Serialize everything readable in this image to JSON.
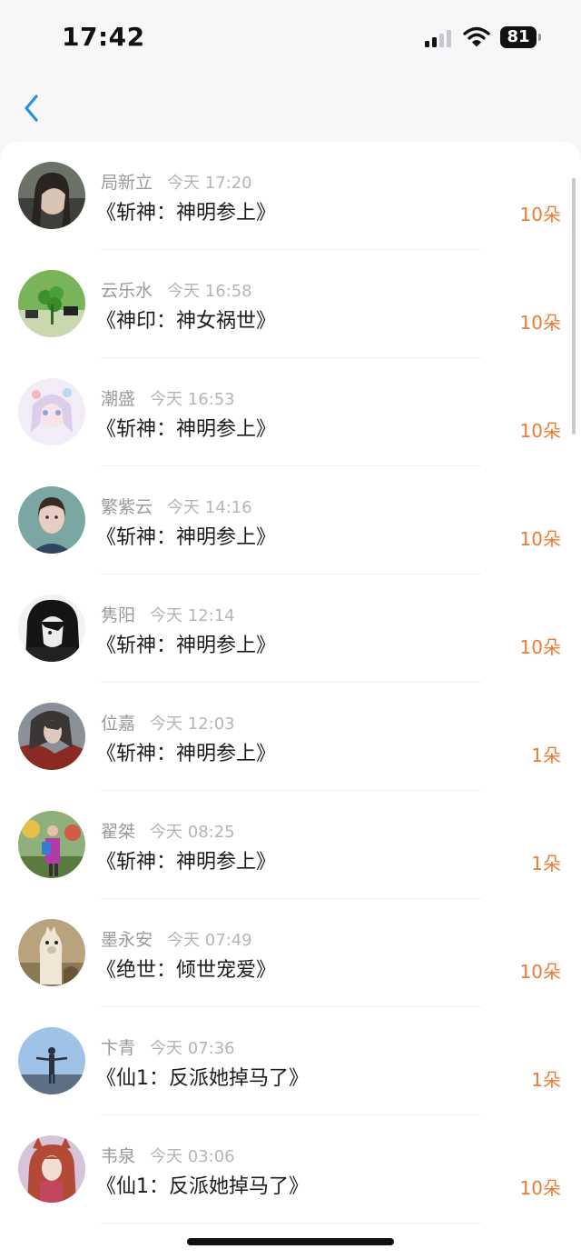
{
  "status_bar": {
    "time": "17:42",
    "battery": "81"
  },
  "list": [
    {
      "name": "局新立",
      "time": "今天 17:20",
      "book": "《斩神：神明参上》",
      "amount": "10朵"
    },
    {
      "name": "云乐水",
      "time": "今天 16:58",
      "book": "《神印：神女祸世》",
      "amount": "10朵"
    },
    {
      "name": "潮盛",
      "time": "今天 16:53",
      "book": "《斩神：神明参上》",
      "amount": "10朵"
    },
    {
      "name": "繁紫云",
      "time": "今天 14:16",
      "book": "《斩神：神明参上》",
      "amount": "10朵"
    },
    {
      "name": "隽阳",
      "time": "今天 12:14",
      "book": "《斩神：神明参上》",
      "amount": "10朵"
    },
    {
      "name": "位嘉",
      "time": "今天 12:03",
      "book": "《斩神：神明参上》",
      "amount": "1朵"
    },
    {
      "name": "翟桀",
      "time": "今天 08:25",
      "book": "《斩神：神明参上》",
      "amount": "1朵"
    },
    {
      "name": "墨永安",
      "time": "今天 07:49",
      "book": "《绝世：倾世宠爱》",
      "amount": "10朵"
    },
    {
      "name": "卞青",
      "time": "今天 07:36",
      "book": "《仙1：反派她掉马了》",
      "amount": "1朵"
    },
    {
      "name": "韦泉",
      "time": "今天 03:06",
      "book": "《仙1：反派她掉马了》",
      "amount": "10朵"
    }
  ],
  "colors": {
    "accent": "#2b8fe0",
    "amount": "#ee7b30"
  },
  "icons": {
    "back": "chevron-left-icon"
  }
}
